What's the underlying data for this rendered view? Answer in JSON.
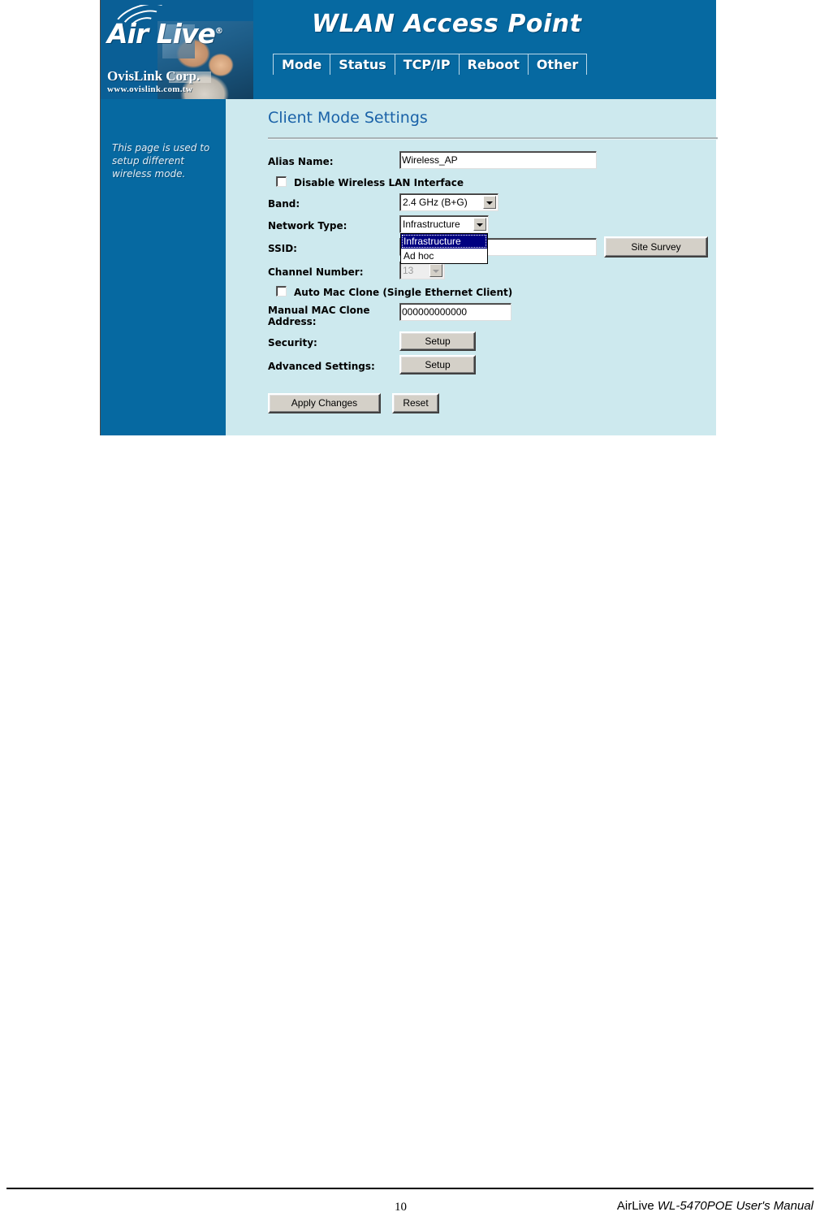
{
  "device_ui": {
    "brand": {
      "wordmark": "Air Live",
      "registered_mark": "®",
      "company": "OvisLink Corp.",
      "website": "www.ovislink.com.tw"
    },
    "banner_title": "WLAN Access Point",
    "nav_tabs": [
      {
        "label": "Mode"
      },
      {
        "label": "Status"
      },
      {
        "label": "TCP/IP"
      },
      {
        "label": "Reboot"
      },
      {
        "label": "Other"
      }
    ],
    "sidebar": {
      "help_text": "This page is used to setup different wireless mode."
    },
    "section": {
      "title": "Client Mode Settings"
    },
    "fields": {
      "alias_name": {
        "label": "Alias Name:",
        "value": "Wireless_AP"
      },
      "disable_wlan": {
        "label": "Disable Wireless LAN Interface",
        "checked": false
      },
      "band": {
        "label": "Band:",
        "value": "2.4 GHz (B+G)"
      },
      "network_type": {
        "label": "Network Type:",
        "value": "Infrastructure",
        "open": true,
        "options": [
          {
            "label": "Infrastructure",
            "selected": true
          },
          {
            "label": "Ad hoc",
            "selected": false
          }
        ]
      },
      "ssid": {
        "label": "SSID:",
        "value": ""
      },
      "site_survey_button": "Site Survey",
      "channel_number": {
        "label": "Channel Number:",
        "value": "13",
        "disabled": true
      },
      "auto_mac_clone": {
        "label": "Auto Mac Clone (Single Ethernet Client)",
        "checked": false
      },
      "manual_mac_clone": {
        "label_line1": "Manual MAC Clone",
        "label_line2": "Address:",
        "value": "000000000000"
      },
      "security": {
        "label": "Security:",
        "button": "Setup"
      },
      "advanced_settings": {
        "label": "Advanced Settings:",
        "button": "Setup"
      }
    },
    "actions": {
      "apply": "Apply Changes",
      "reset": "Reset"
    },
    "colors": {
      "banner_blue": "#0669a1",
      "body_cyan": "#cde9ee",
      "heading_blue": "#1a62a8",
      "dropdown_highlight": "#000080"
    }
  },
  "document_footer": {
    "page_number": "10",
    "manual_prefix": "AirLive ",
    "manual_title": "WL-5470POE User's Manual"
  }
}
